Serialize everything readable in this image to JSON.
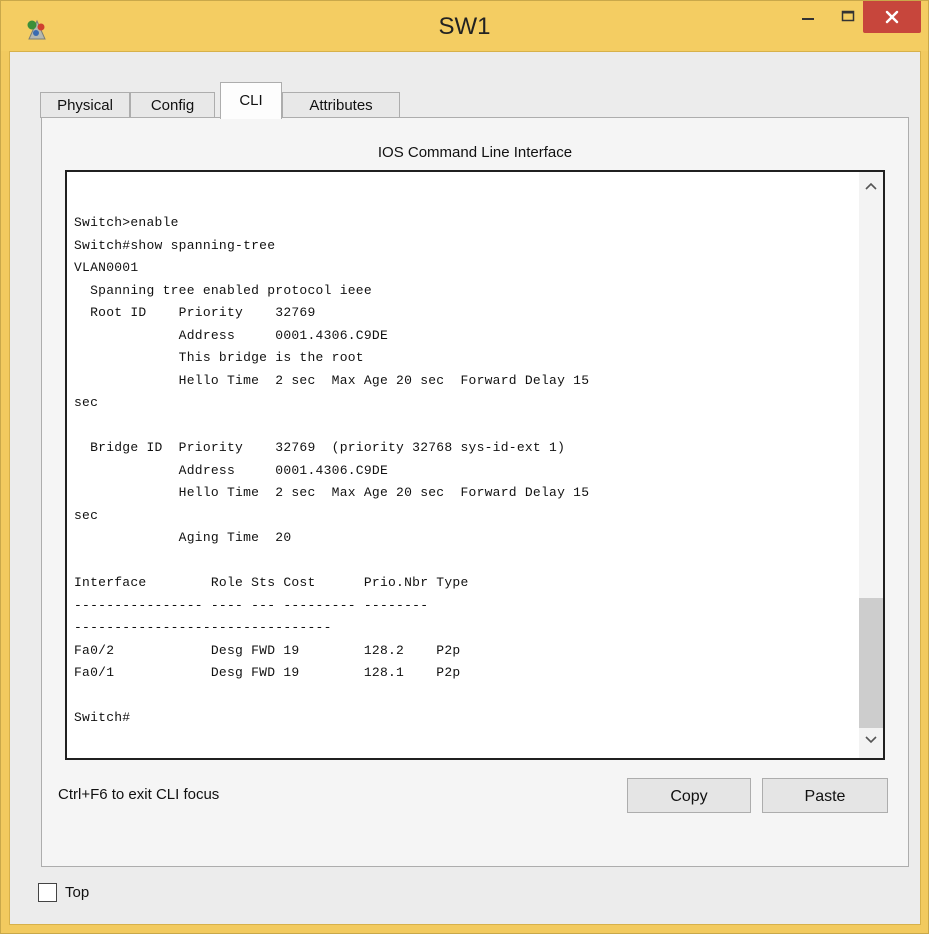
{
  "window": {
    "title": "SW1",
    "accent_color": "#f4cd62",
    "close_color": "#c7463c",
    "app_icon": "packet-tracer-icon"
  },
  "tabs": [
    {
      "label": "Physical",
      "active": false
    },
    {
      "label": "Config",
      "active": false
    },
    {
      "label": "CLI",
      "active": true
    },
    {
      "label": "Attributes",
      "active": false
    }
  ],
  "cli": {
    "section_title": "IOS Command Line Interface",
    "output": "Switch>enable\nSwitch#show spanning-tree\nVLAN0001\n  Spanning tree enabled protocol ieee\n  Root ID    Priority    32769\n             Address     0001.4306.C9DE\n             This bridge is the root\n             Hello Time  2 sec  Max Age 20 sec  Forward Delay 15\nsec\n\n  Bridge ID  Priority    32769  (priority 32768 sys-id-ext 1)\n             Address     0001.4306.C9DE\n             Hello Time  2 sec  Max Age 20 sec  Forward Delay 15\nsec\n             Aging Time  20\n\nInterface        Role Sts Cost      Prio.Nbr Type\n---------------- ---- --- --------- --------\n--------------------------------\nFa0/2            Desg FWD 19        128.2    P2p\nFa0/1            Desg FWD 19        128.1    P2p\n\nSwitch#",
    "hint": "Ctrl+F6 to exit CLI focus",
    "copy_label": "Copy",
    "paste_label": "Paste"
  },
  "footer": {
    "top_label": "Top",
    "top_checked": false
  }
}
